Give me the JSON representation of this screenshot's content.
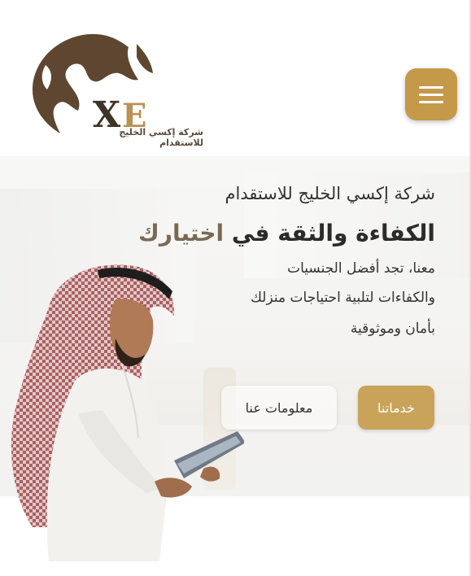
{
  "header": {
    "logo_caption": "شركة إكسي الخليج للاستقدام",
    "logo_letters": "XE",
    "menu_icon": "hamburger-menu-icon"
  },
  "hero": {
    "company": "شركة إكسي الخليج للاستقدام",
    "headline_main": "الكفاءة والثقة في ",
    "headline_accent": "اختيارك",
    "description_lines": [
      "معنا، تجد أفضل الجنسيات",
      "والكفاءات لتلبية احتياجات منزلك",
      "بأمان وموثوقية"
    ],
    "buttons": {
      "services": "خدماتنا",
      "about": "معلومات عنا"
    }
  },
  "colors": {
    "accent_gold": "#c49a4a",
    "logo_brown": "#5e4630"
  }
}
